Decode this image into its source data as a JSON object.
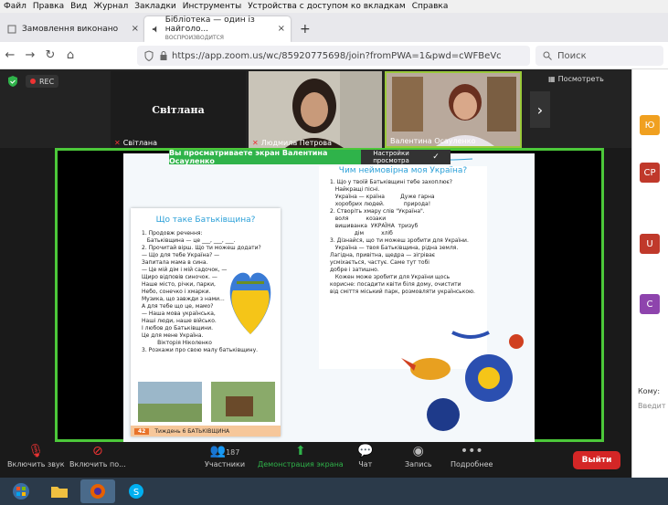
{
  "menu": [
    "Файл",
    "Правка",
    "Вид",
    "Журнал",
    "Закладки",
    "Инструменты",
    "Устройства с доступом ко вкладкам",
    "Справка"
  ],
  "tabs": [
    {
      "label": "Замовлення виконано",
      "close": "×"
    },
    {
      "label": "Бібліотека — один із найголо...",
      "sub": "ВОСПРОИЗВОДИТСЯ",
      "close": "×"
    }
  ],
  "new_tab": "+",
  "nav": {
    "back": "←",
    "forward": "→",
    "reload": "↻",
    "home": "⌂",
    "url": "https://app.zoom.us/wc/85920775698/join?fromPWA=1&pwd=cWFBeVc",
    "search_placeholder": "Поиск"
  },
  "zoom": {
    "rec": "REC",
    "view_label": "Посмотреть",
    "tiles": [
      {
        "name": "Світлана",
        "big": "Світлана"
      },
      {
        "name": "Людмила Петрова"
      },
      {
        "name": "Валентина Осауленко"
      }
    ],
    "banner": "Вы просматриваете экран  Валентина Осауленко",
    "banner_btn": "Настройки просмотра",
    "banner_check": "✓",
    "toolbar": {
      "mute": "Включить звук",
      "video": "Включить по...",
      "participants": "Участники",
      "participants_count": "187",
      "share": "Демонстрация экрана",
      "chat": "Чат",
      "record": "Запись",
      "more": "Подробнее",
      "leave": "Выйти"
    }
  },
  "book": {
    "left_title": "Що таке Батьківщина?",
    "left_lines": [
      "1. Продовж речення:",
      "   Батьківщина — це ___, ___, ___.",
      "2. Прочитай вірш. Що ти можеш додати?",
      "— Що для тебе Україна? —",
      "Запитала мама в сина.",
      "— Це мій дім і мій садочок, —",
      "Щиро відповів синочок. —",
      "Наше місто, річки, парки,",
      "Небо, сонечко і хмарки.",
      "Музика, що завжди з нами...",
      "А для тебе що це, мамо?",
      "— Наша мова українська,",
      "Наші люди, наше військо.",
      "І любов до Батьківщини.",
      "Це для мене Україна.",
      "         Вікторія Ніколенко",
      "3. Розкажи про свою малу батьківщину."
    ],
    "page_num": "42",
    "page_footer": "Тиждень 6  БАТЬКІВЩИНА",
    "right_title": "Чим неймовірна моя Україна?",
    "right_lines": [
      "1. Що у твоїй Батьківщині тебе захоплює?",
      "   Найкращі пісні.",
      "   Україна — країна         Дуже гарна",
      "   хоробрих людей.           природа!",
      "2. Створіть хмару слів \"Україна\".",
      "   воля          козаки",
      "   вишиванка  УКРАЇНА  тризуб",
      "              дім          хліб",
      "3. Дізнайся, що ти можеш зробити для України.",
      "   Україна — твоя Батьківщина, рідна земля.",
      "Лагідна, привітна, щедра — зігріває",
      "усміхається, частує. Саме тут тобі",
      "добре і затишно.",
      "   Кожен може зробити для України щось",
      "корисне: посадити квіти біля дому, очистити",
      "від сміття міський парк, розмовляти українською."
    ]
  },
  "panel": {
    "avatars": [
      {
        "text": "Ю",
        "color": "#f0a020"
      },
      {
        "text": "СР",
        "color": "#c0392b"
      },
      {
        "text": "U",
        "color": "#c0392b"
      },
      {
        "text": "С",
        "color": "#8e44ad"
      }
    ],
    "to_label": "Кому:",
    "input_placeholder": "Введит"
  },
  "colors": {
    "accent_green": "#4cc83a",
    "leave_red": "#d42626",
    "book_blue": "#2ba0d8",
    "book_orange": "#e8732a"
  }
}
